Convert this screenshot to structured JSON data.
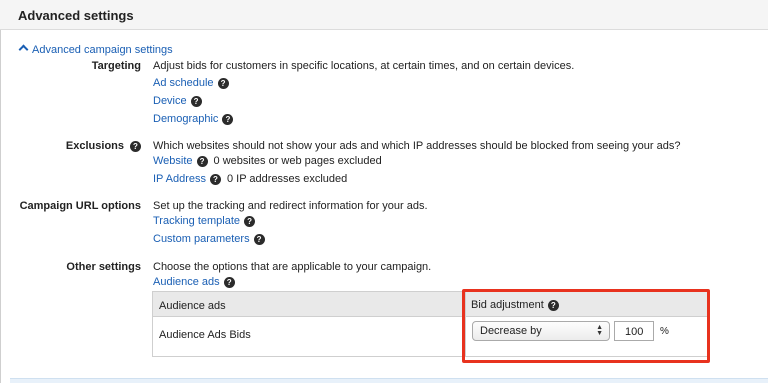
{
  "header": {
    "title": "Advanced settings"
  },
  "section": {
    "toggle_label": "Advanced campaign settings"
  },
  "targeting": {
    "label": "Targeting",
    "description": "Adjust bids for customers in specific locations, at certain times, and on certain devices.",
    "links": [
      "Ad schedule",
      "Device",
      "Demographic"
    ]
  },
  "exclusions": {
    "label": "Exclusions",
    "description": "Which websites should not show your ads and which IP addresses should be blocked from seeing your ads?",
    "website_link": "Website",
    "website_status": "0 websites or web pages excluded",
    "ip_link": "IP Address",
    "ip_status": "0 IP addresses excluded"
  },
  "url_options": {
    "label": "Campaign URL options",
    "description": "Set up the tracking and redirect information for your ads.",
    "links": [
      "Tracking template",
      "Custom parameters"
    ]
  },
  "other": {
    "label": "Other settings",
    "description": "Choose the options that are applicable to your campaign.",
    "link": "Audience ads"
  },
  "table": {
    "col1": "Audience ads",
    "col2": "Bid adjustment",
    "row_label": "Audience Ads Bids",
    "select_value": "Decrease by",
    "amount": "100",
    "unit": "%"
  },
  "colors": {
    "link": "#1a5fb4",
    "highlight": "#e8321e"
  },
  "icons": {
    "help": "question-circle-icon",
    "toggle": "chevron-up-icon",
    "select": "up-down-arrows-icon"
  }
}
